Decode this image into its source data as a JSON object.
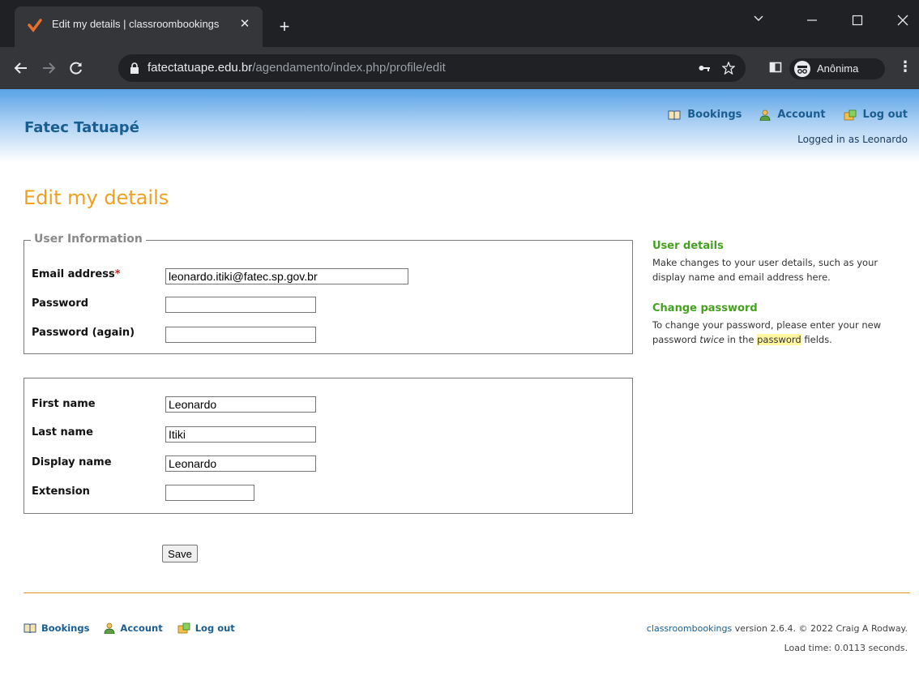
{
  "browser": {
    "tab_title": "Edit my details | classroombookings",
    "tab_close": "✕",
    "new_tab": "+",
    "url_host": "fatectatuape.edu.br",
    "url_path": "/agendamento/index.php/profile/edit",
    "profile_label": "Anônima",
    "icons": [
      "favicon-icon",
      "lock-icon",
      "key-icon",
      "star-icon",
      "sidepanel-icon",
      "incognito-icon",
      "menu-icon"
    ]
  },
  "header": {
    "site_title": "Fatec Tatuapé",
    "nav": {
      "bookings": "Bookings",
      "account": "Account",
      "logout": "Log out"
    },
    "logged_in": "Logged in as Leonardo"
  },
  "main": {
    "heading": "Edit my details",
    "user_info": {
      "legend": "User Information",
      "email_label": "Email address",
      "required_mark": "*",
      "email_value": "leonardo.itiki@fatec.sp.gov.br",
      "password_label": "Password",
      "password_value": "",
      "password_again_label": "Password (again)",
      "password_again_value": ""
    },
    "personal": {
      "first_name_label": "First name",
      "first_name_value": "Leonardo",
      "last_name_label": "Last name",
      "last_name_value": "Itiki",
      "display_name_label": "Display name",
      "display_name_value": "Leonardo",
      "extension_label": "Extension",
      "extension_value": ""
    },
    "save_label": "Save"
  },
  "sidebar": {
    "details_heading": "User details",
    "details_text": "Make changes to your user details, such as your display name and email address here.",
    "password_heading": "Change password",
    "password_text_1": "To change your password, please enter your new password ",
    "password_text_em": "twice",
    "password_text_2": " in the ",
    "password_text_hl": "password",
    "password_text_3": " fields."
  },
  "footer": {
    "nav": {
      "bookings": "Bookings",
      "account": "Account",
      "logout": "Log out"
    },
    "product": "classroombookings",
    "version_text": " version 2.6.4. © 2022 Craig A Rodway.",
    "load_time": "Load time: 0.0113 seconds."
  },
  "colors": {
    "accent_orange": "#f0a020",
    "link_blue": "#1a5e91",
    "sidebar_green": "#45a020"
  }
}
